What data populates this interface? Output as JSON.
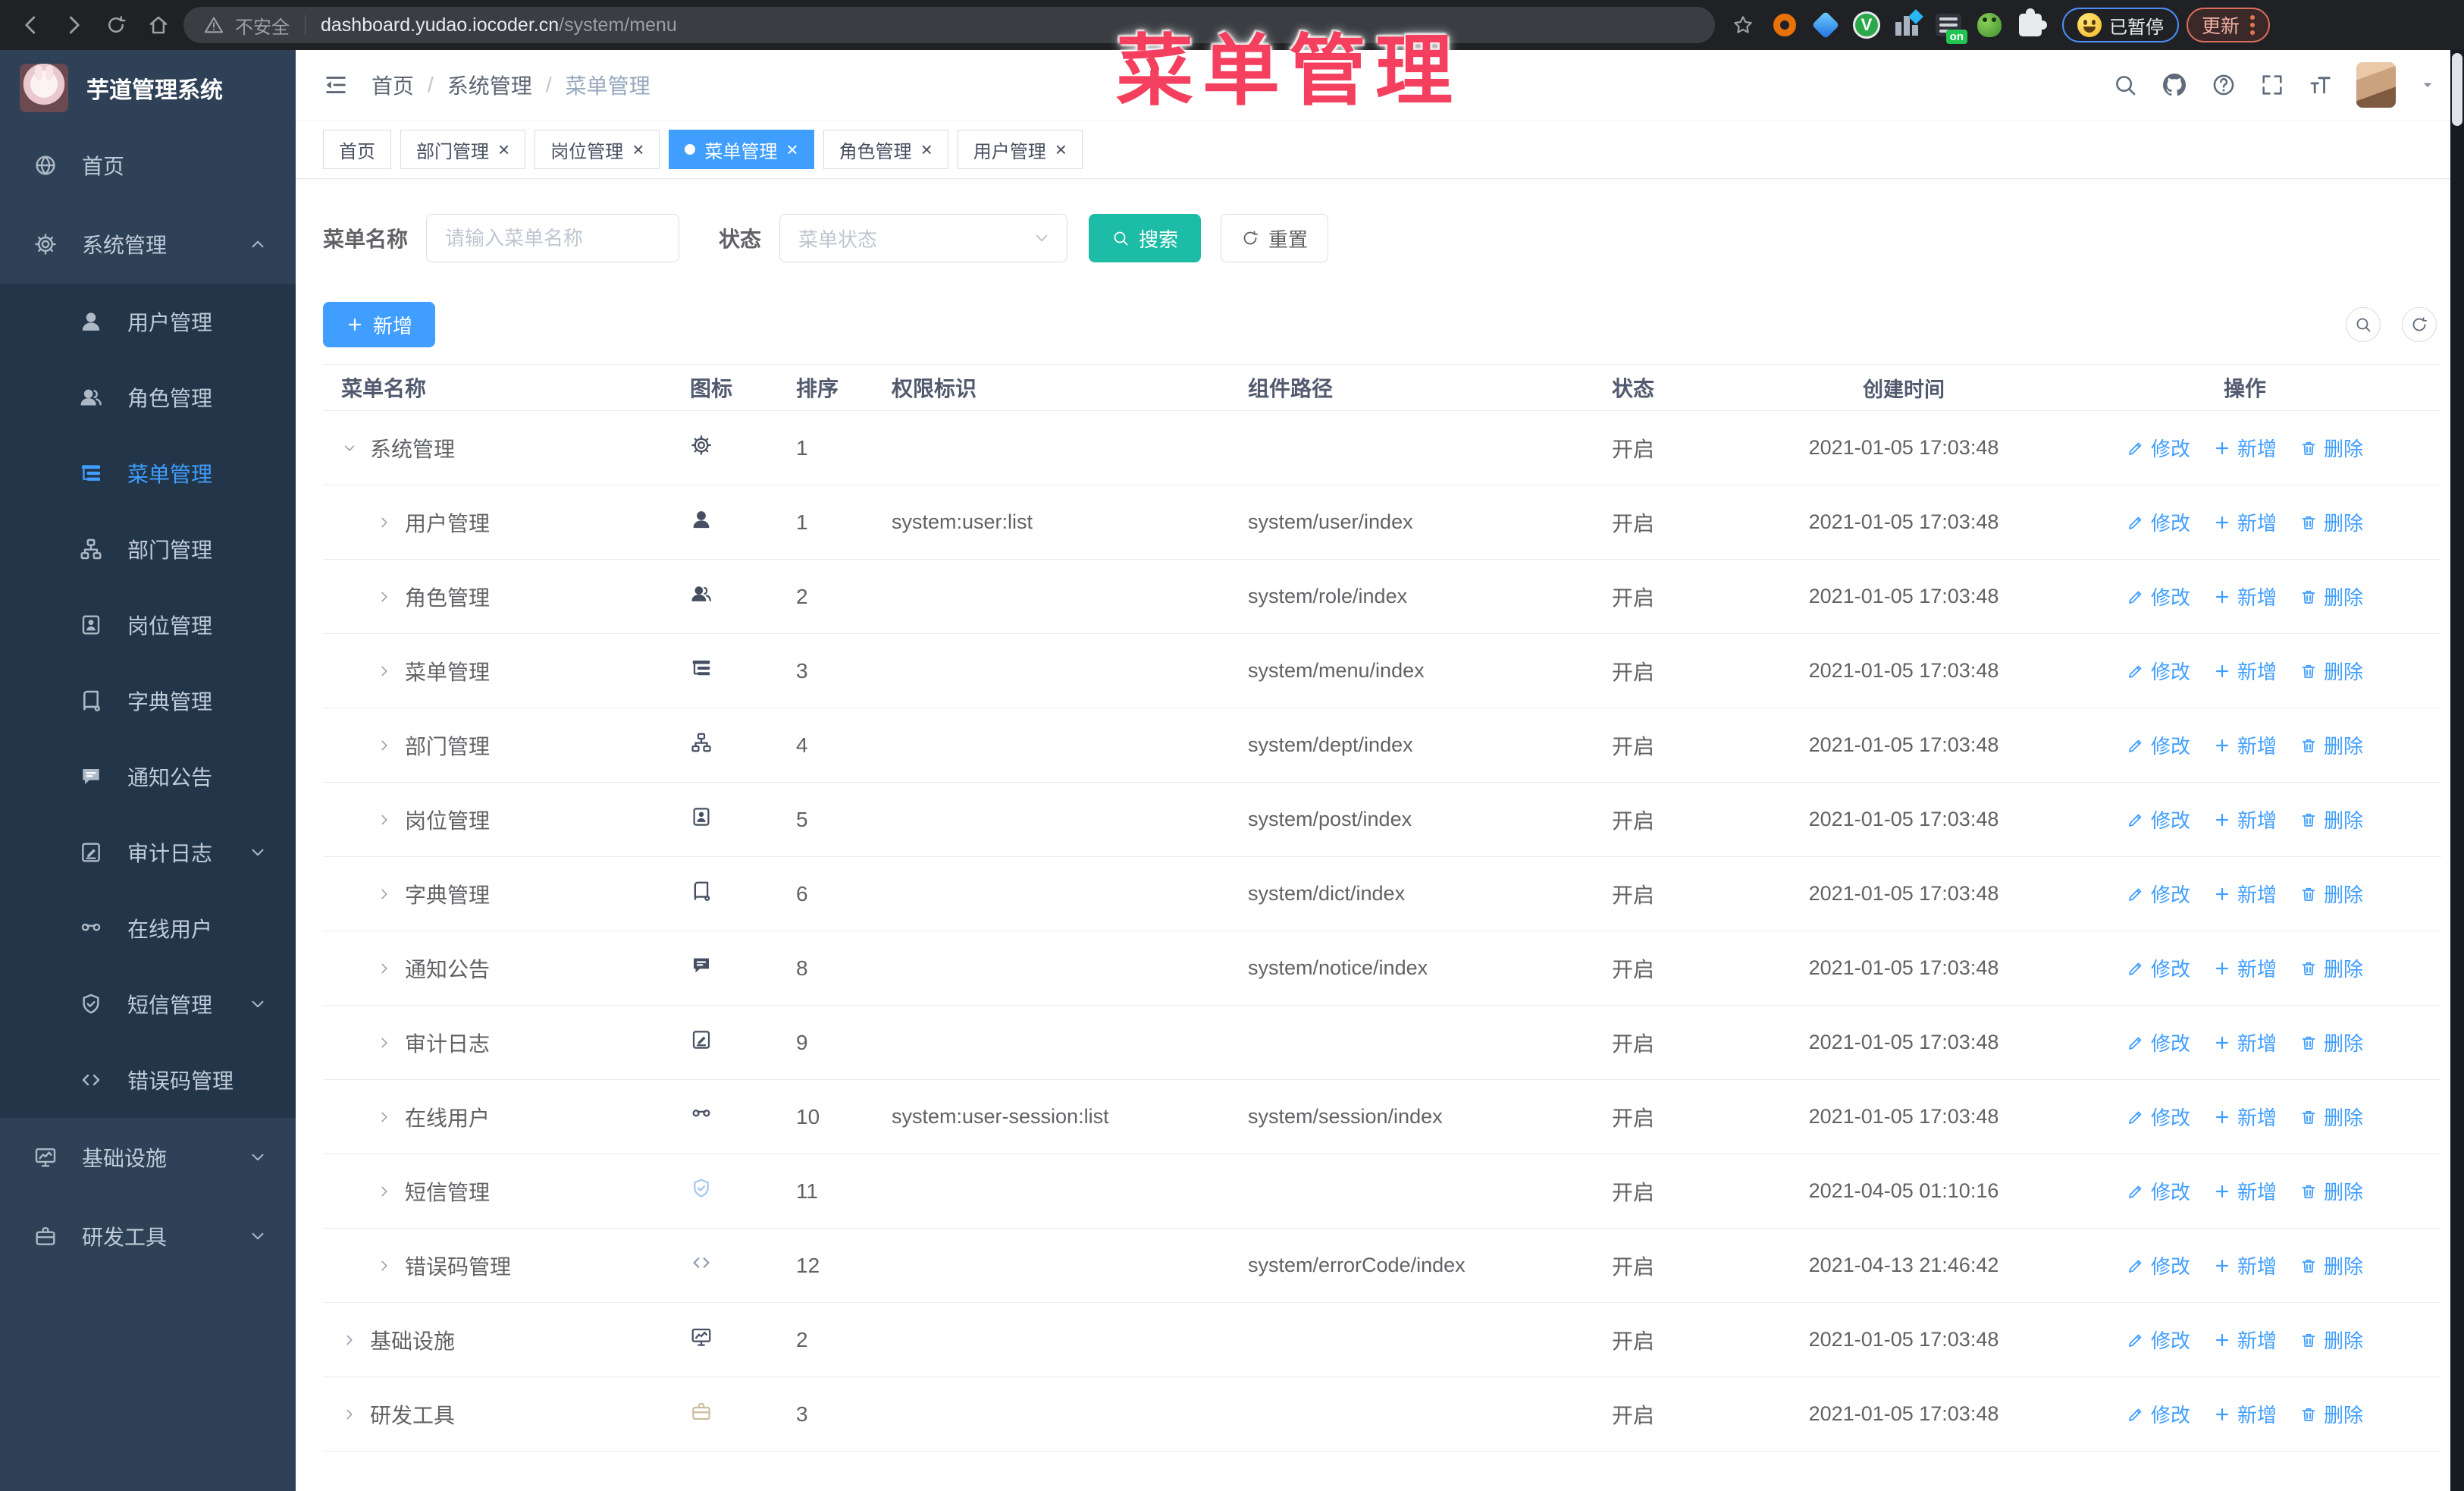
{
  "annotation": {
    "text": "菜单管理"
  },
  "colors": {
    "accent": "#409eff",
    "teal": "#1cbca6",
    "annot": "#f43f5e",
    "chrome_bg": "#202124",
    "omnibox_bg": "#3a3d42",
    "sidebar_bg": "#2e4156",
    "submenu_bg": "#233649",
    "sidebar_text": "#bfcbd9"
  },
  "browser": {
    "security_label": "不安全",
    "url_domain": "dashboard.yudao.iocoder.cn",
    "url_path": "/system/menu",
    "paused_label": "已暂停",
    "update_label": "更新"
  },
  "sidebar": {
    "logo_title": "芋道管理系统",
    "items": [
      {
        "label": "首页",
        "icon": "globe",
        "level": 1
      },
      {
        "label": "系统管理",
        "icon": "gear",
        "level": 1,
        "chevron": "up"
      },
      {
        "label": "用户管理",
        "icon": "user",
        "level": 2
      },
      {
        "label": "角色管理",
        "icon": "users",
        "level": 2
      },
      {
        "label": "菜单管理",
        "icon": "tree-table",
        "level": 2,
        "active": true
      },
      {
        "label": "部门管理",
        "icon": "tree",
        "level": 2
      },
      {
        "label": "岗位管理",
        "icon": "badge",
        "level": 2
      },
      {
        "label": "字典管理",
        "icon": "book",
        "level": 2
      },
      {
        "label": "通知公告",
        "icon": "message",
        "level": 2
      },
      {
        "label": "审计日志",
        "icon": "edit-log",
        "level": 2,
        "chevron": "down"
      },
      {
        "label": "在线用户",
        "icon": "online",
        "level": 2
      },
      {
        "label": "短信管理",
        "icon": "shield",
        "level": 2,
        "chevron": "down"
      },
      {
        "label": "错误码管理",
        "icon": "code",
        "level": 2
      },
      {
        "label": "基础设施",
        "icon": "monitor",
        "level": 1,
        "chevron": "down"
      },
      {
        "label": "研发工具",
        "icon": "briefcase",
        "level": 1,
        "chevron": "down"
      }
    ]
  },
  "header": {
    "breadcrumb": [
      "首页",
      "系统管理",
      "菜单管理"
    ]
  },
  "tabs": [
    {
      "label": "首页",
      "closable": false,
      "active": false
    },
    {
      "label": "部门管理",
      "closable": true,
      "active": false
    },
    {
      "label": "岗位管理",
      "closable": true,
      "active": false
    },
    {
      "label": "菜单管理",
      "closable": true,
      "active": true
    },
    {
      "label": "角色管理",
      "closable": true,
      "active": false
    },
    {
      "label": "用户管理",
      "closable": true,
      "active": false
    }
  ],
  "filter": {
    "name_label": "菜单名称",
    "name_placeholder": "请输入菜单名称",
    "status_label": "状态",
    "status_placeholder": "菜单状态",
    "search_label": "搜索",
    "reset_label": "重置"
  },
  "toolbar": {
    "add_label": "新增"
  },
  "table": {
    "headers": [
      "菜单名称",
      "图标",
      "排序",
      "权限标识",
      "组件路径",
      "状态",
      "创建时间",
      "操作"
    ],
    "action_labels": {
      "edit": "修改",
      "add": "新增",
      "delete": "删除"
    },
    "rows": [
      {
        "name": "系统管理",
        "icon": "gear",
        "sort": "1",
        "perm": "",
        "path": "",
        "status": "开启",
        "time": "2021-01-05 17:03:48",
        "level": 1,
        "expanded": true
      },
      {
        "name": "用户管理",
        "icon": "user",
        "sort": "1",
        "perm": "system:user:list",
        "path": "system/user/index",
        "status": "开启",
        "time": "2021-01-05 17:03:48",
        "level": 2
      },
      {
        "name": "角色管理",
        "icon": "users",
        "sort": "2",
        "perm": "",
        "path": "system/role/index",
        "status": "开启",
        "time": "2021-01-05 17:03:48",
        "level": 2
      },
      {
        "name": "菜单管理",
        "icon": "tree-table",
        "sort": "3",
        "perm": "",
        "path": "system/menu/index",
        "status": "开启",
        "time": "2021-01-05 17:03:48",
        "level": 2
      },
      {
        "name": "部门管理",
        "icon": "tree",
        "sort": "4",
        "perm": "",
        "path": "system/dept/index",
        "status": "开启",
        "time": "2021-01-05 17:03:48",
        "level": 2
      },
      {
        "name": "岗位管理",
        "icon": "badge",
        "sort": "5",
        "perm": "",
        "path": "system/post/index",
        "status": "开启",
        "time": "2021-01-05 17:03:48",
        "level": 2
      },
      {
        "name": "字典管理",
        "icon": "book",
        "sort": "6",
        "perm": "",
        "path": "system/dict/index",
        "status": "开启",
        "time": "2021-01-05 17:03:48",
        "level": 2
      },
      {
        "name": "通知公告",
        "icon": "message",
        "sort": "8",
        "perm": "",
        "path": "system/notice/index",
        "status": "开启",
        "time": "2021-01-05 17:03:48",
        "level": 2
      },
      {
        "name": "审计日志",
        "icon": "edit-log",
        "sort": "9",
        "perm": "",
        "path": "",
        "status": "开启",
        "time": "2021-01-05 17:03:48",
        "level": 2
      },
      {
        "name": "在线用户",
        "icon": "online",
        "sort": "10",
        "perm": "system:user-session:list",
        "path": "system/session/index",
        "status": "开启",
        "time": "2021-01-05 17:03:48",
        "level": 2
      },
      {
        "name": "短信管理",
        "icon": "shield",
        "sort": "11",
        "perm": "",
        "path": "",
        "status": "开启",
        "time": "2021-04-05 01:10:16",
        "level": 2,
        "icon_color": "#a8c6e8"
      },
      {
        "name": "错误码管理",
        "icon": "code",
        "sort": "12",
        "perm": "",
        "path": "system/errorCode/index",
        "status": "开启",
        "time": "2021-04-13 21:46:42",
        "level": 2,
        "icon_color": "#8f9bb0"
      },
      {
        "name": "基础设施",
        "icon": "monitor",
        "sort": "2",
        "perm": "",
        "path": "",
        "status": "开启",
        "time": "2021-01-05 17:03:48",
        "level": 1
      },
      {
        "name": "研发工具",
        "icon": "briefcase",
        "sort": "3",
        "perm": "",
        "path": "",
        "status": "开启",
        "time": "2021-01-05 17:03:48",
        "level": 1,
        "icon_color": "#cbbd9e"
      }
    ]
  }
}
